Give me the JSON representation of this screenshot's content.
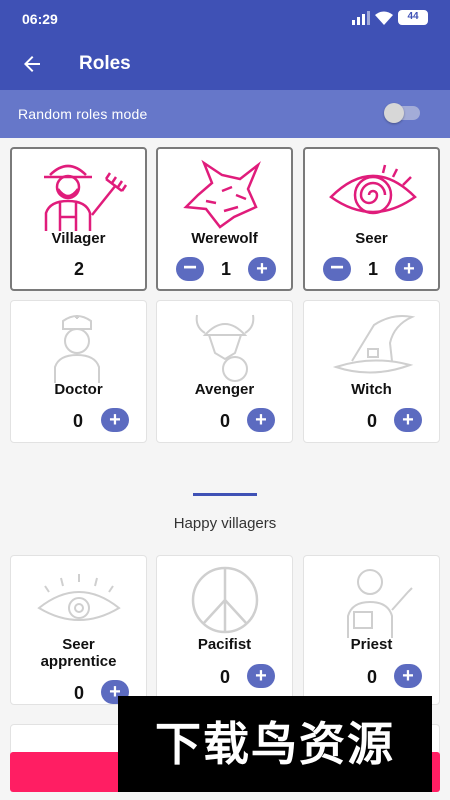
{
  "status_bar": {
    "time": "06:29",
    "battery": "44"
  },
  "app_bar": {
    "title": "Roles"
  },
  "random_mode": {
    "label": "Random roles mode",
    "enabled": false
  },
  "roles": [
    {
      "name": "Villager",
      "count": "2",
      "selected": true,
      "icon": "farmer-pitchfork-icon"
    },
    {
      "name": "Werewolf",
      "count": "1",
      "selected": true,
      "icon": "wolf-head-icon"
    },
    {
      "name": "Seer",
      "count": "1",
      "selected": true,
      "icon": "spiral-eye-icon"
    },
    {
      "name": "Doctor",
      "count": "0",
      "selected": false,
      "icon": "nurse-icon"
    },
    {
      "name": "Avenger",
      "count": "0",
      "selected": false,
      "icon": "viking-fox-icon"
    },
    {
      "name": "Witch",
      "count": "0",
      "selected": false,
      "icon": "witch-hat-icon"
    }
  ],
  "section": {
    "title": "Happy villagers"
  },
  "villager_roles": [
    {
      "name": "Seer apprentice",
      "name_line1": "Seer",
      "name_line2": "apprentice",
      "count": "0",
      "icon": "eye-icon"
    },
    {
      "name": "Pacifist",
      "count": "0",
      "icon": "peace-sign-icon"
    },
    {
      "name": "Priest",
      "count": "0",
      "icon": "priest-icon"
    }
  ],
  "watermark": {
    "text": "下载鸟资源"
  },
  "colors": {
    "primary": "#3f51b5",
    "accent_button": "#5c6bc0",
    "role_art": "#e01c7b",
    "inactive_art": "#cfcfcf",
    "bottom_button": "#ff1e63"
  }
}
